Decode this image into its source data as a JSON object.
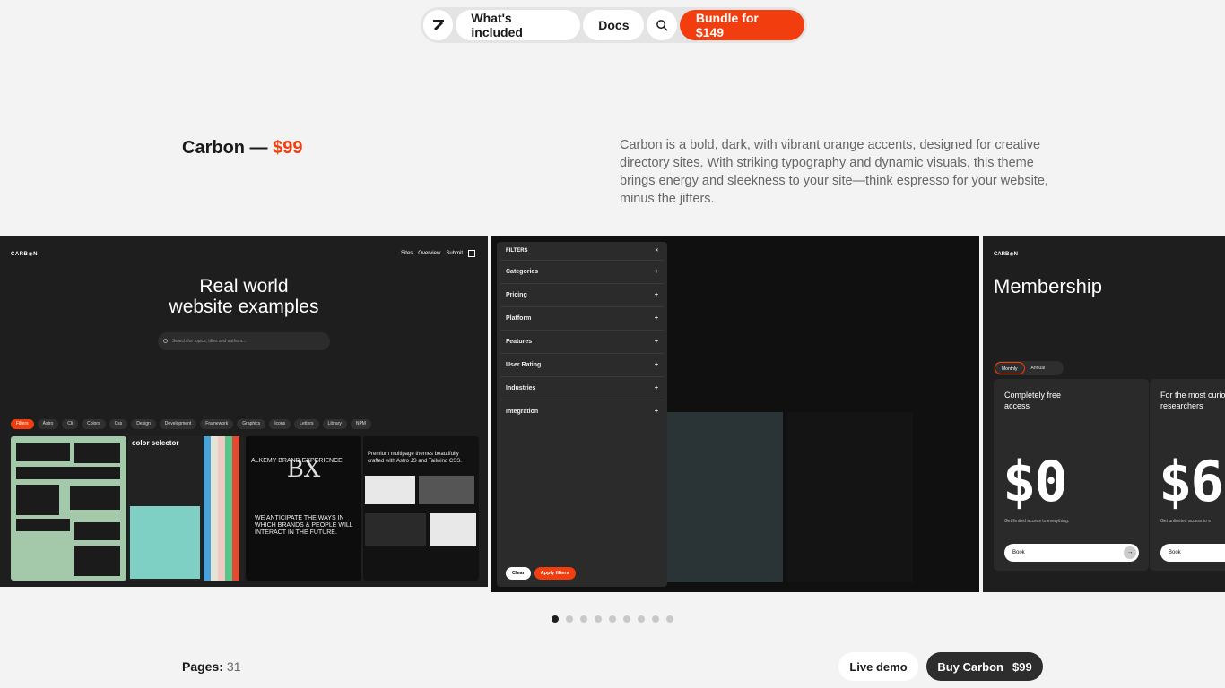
{
  "nav": {
    "logo_icon": "arrow-up-right-icon",
    "whats_included": "What's included",
    "docs": "Docs",
    "search_icon": "search-icon",
    "bundle": "Bundle for $149"
  },
  "theme": {
    "name": "Carbon — ",
    "price": "$99",
    "description": "Carbon is a bold, dark, with vibrant orange accents, designed for creative directory sites. With striking typography and dynamic visuals, this theme brings energy and sleekness to your site—think espresso for your website, minus the jitters."
  },
  "slide1": {
    "logo": "CARB◉N",
    "nav": [
      "Sites",
      "Overview",
      "Submit"
    ],
    "hero_line1": "Real world",
    "hero_line2": "website examples",
    "search_placeholder": "Search for topics, titles and authors...",
    "chips": [
      "Filters",
      "Astro",
      "Cli",
      "Colors",
      "Css",
      "Design",
      "Development",
      "Framework",
      "Graphics",
      "Icons",
      "Letters",
      "Library",
      "NPM"
    ],
    "thumb2_label": "color selector",
    "thumb3_title": "ALKEMY BRAND EXPERIENCE",
    "thumb3_text": "WE ANTICIPATE THE WAYS IN WHICH BRANDS & PEOPLE WILL INTERACT IN THE FUTURE.",
    "thumb4_text": "Premium multipage themes beautifully crafted with Astro JS and Tailwind CSS."
  },
  "slide2": {
    "filters_title": "FILTERS",
    "close": "×",
    "rows": [
      "Categories",
      "Pricing",
      "Platform",
      "Features",
      "User Rating",
      "Industries",
      "Integration"
    ],
    "plus": "+",
    "clear": "Clear",
    "apply": "Apply filters"
  },
  "slide3": {
    "logo": "CARB◉N",
    "title": "Membership",
    "toggle": [
      "Monthly",
      "Annual"
    ],
    "plans": [
      {
        "title": "Completely free access",
        "amount": "$0",
        "note": "Get limited access to everything.",
        "cta": "Book"
      },
      {
        "title": "For the most curious researchers",
        "amount": "$6",
        "note": "Get unlimited access to e",
        "cta": "Book"
      }
    ]
  },
  "carousel": {
    "total_slides": 9,
    "active_index": 0
  },
  "footer": {
    "pages_label": "Pages:",
    "pages_value": "31",
    "live_demo": "Live demo",
    "buy_label": "Buy Carbon",
    "buy_price": "$99"
  },
  "colors": {
    "accent": "#f23d0f",
    "dark": "#1e1e1f",
    "background": "#f3f3f3"
  }
}
